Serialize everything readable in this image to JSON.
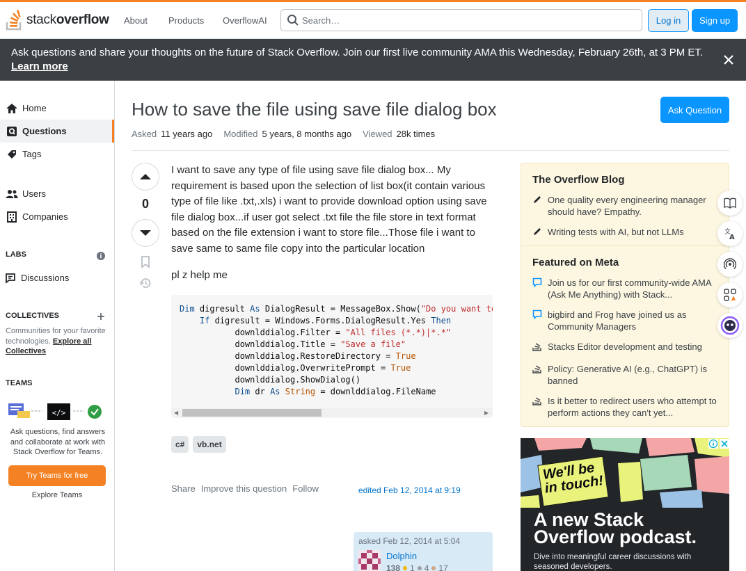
{
  "header": {
    "logo_regular": "stack",
    "logo_bold": "overflow",
    "nav": [
      "About",
      "Products",
      "OverflowAI"
    ],
    "search_placeholder": "Search…",
    "login_label": "Log in",
    "signup_label": "Sign up"
  },
  "banner": {
    "text": "Ask questions and share your thoughts on the future of Stack Overflow. Join our first live community AMA this Wednesday, February 26th, at 3 PM ET.",
    "link": "Learn more"
  },
  "sidebar": {
    "items": [
      {
        "label": "Home",
        "icon": "home-icon"
      },
      {
        "label": "Questions",
        "icon": "questions-icon",
        "active": true
      },
      {
        "label": "Tags",
        "icon": "tag-icon"
      },
      {
        "label": "Users",
        "icon": "users-icon"
      },
      {
        "label": "Companies",
        "icon": "companies-icon"
      }
    ],
    "labs_heading": "LABS",
    "discussions_label": "Discussions",
    "collectives_heading": "COLLECTIVES",
    "collectives_text": "Communities for your favorite technologies.",
    "collectives_link": "Explore all Collectives",
    "teams_heading": "TEAMS",
    "teams_text": "Ask questions, find answers and collaborate at work with Stack Overflow for Teams.",
    "teams_button": "Try Teams for free",
    "explore_teams": "Explore Teams"
  },
  "question": {
    "title": "How to save the file using save file dialog box",
    "ask_button": "Ask Question",
    "asked_label": "Asked",
    "asked_value": "11 years ago",
    "modified_label": "Modified",
    "modified_value": "5 years, 8 months ago",
    "viewed_label": "Viewed",
    "viewed_value": "28k times",
    "votes": "0",
    "body_p1": "I want to save any type of file using save file dialog box... My requirement is based upon the selection of list box(it contain various type of file like .txt,.xls) i want to provide download option using save file dialog box...if user got select .txt file the file store in text format based on the file extension i want to store file...Those file i want to save same to same file copy into the particular location",
    "body_p2": "pl z help me",
    "tags": [
      "c#",
      "vb.net"
    ],
    "menu": [
      "Share",
      "Improve this question",
      "Follow"
    ],
    "edited": "edited Feb 12, 2014 at 9:19",
    "asked_card": "asked Feb 12, 2014 at 5:04",
    "user_name": "Dolphin",
    "user_rep": "138",
    "badges": {
      "gold": "1",
      "silver": "4",
      "bronze": "17"
    }
  },
  "blog": {
    "heading": "The Overflow Blog",
    "items": [
      "One quality every engineering manager should have? Empathy.",
      "Writing tests with AI, but not LLMs"
    ],
    "meta_heading": "Featured on Meta",
    "meta_items": [
      "Join us for our first community-wide AMA (Ask Me Anything) with Stack...",
      "bigbird and Frog have joined us as Community Managers",
      "Stacks Editor development and testing",
      "Policy: Generative AI (e.g., ChatGPT) is banned",
      "Is it better to redirect users who attempt to perform actions they can't yet..."
    ]
  },
  "ad": {
    "sticker": "We'll be in touch!",
    "headline_1": "A new Stack",
    "headline_2": "Overflow podcast.",
    "sub": "Dive into meaningful career discussions with seasoned developers."
  },
  "colors": {
    "brand_orange": "#f48225",
    "link_blue": "#0074cc",
    "button_blue": "#0a95ff",
    "banner_bg": "#3b4045",
    "blog_bg": "#fdf7e2"
  }
}
